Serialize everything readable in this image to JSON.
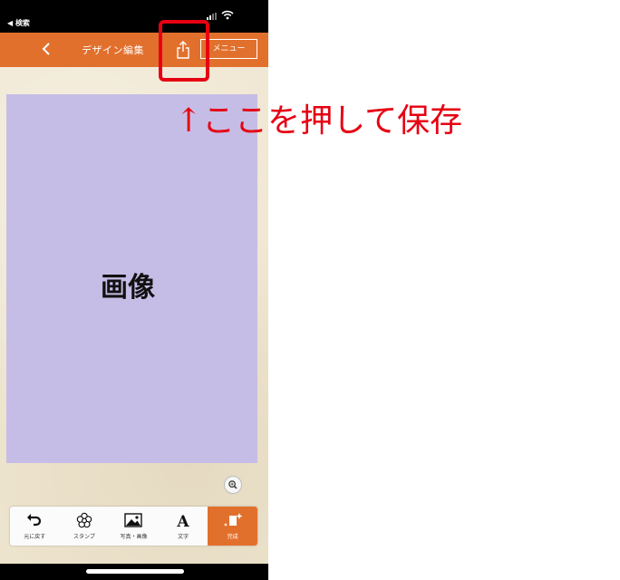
{
  "status_bar": {
    "back_app": "◀ 検索"
  },
  "navbar": {
    "title": "デザイン編集",
    "menu_label": "メニュー"
  },
  "canvas": {
    "image_label": "画像"
  },
  "toolbar": {
    "items": [
      {
        "label": "元に戻す",
        "icon": "undo-icon"
      },
      {
        "label": "スタンプ",
        "icon": "stamp-flower-icon"
      },
      {
        "label": "写真・画像",
        "icon": "photo-icon"
      },
      {
        "label": "文字",
        "icon": "text-A-icon"
      },
      {
        "label": "完成",
        "icon": "sparkle-complete-icon"
      }
    ]
  },
  "annotation": {
    "text": "↑ここを押して保存"
  },
  "colors": {
    "accent": "#e2702d",
    "image_placeholder": "#c6bde6",
    "annotation": "#e60012"
  }
}
